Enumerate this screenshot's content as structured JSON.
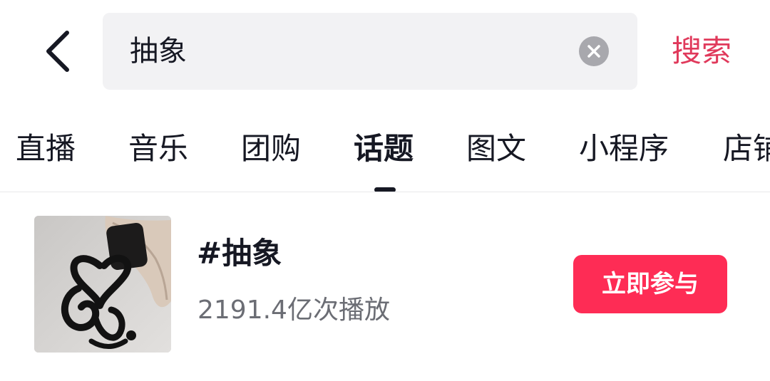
{
  "search": {
    "query": "抽象",
    "back_icon": "chevron-left-icon",
    "clear_icon": "close-circle-icon",
    "submit_label": "搜索",
    "submit_color": "#e0395b"
  },
  "tabs": [
    {
      "label": "直播"
    },
    {
      "label": "音乐"
    },
    {
      "label": "团购"
    },
    {
      "label": "话题",
      "active": true
    },
    {
      "label": "图文"
    },
    {
      "label": "小程序"
    },
    {
      "label": "店铺"
    }
  ],
  "topic": {
    "title": "#抽象",
    "plays": "2191.4亿次播放",
    "action_label": "立即参与",
    "action_color": "#fe2c55",
    "thumbnail_icon": "abstract-heart-drawing-image"
  }
}
